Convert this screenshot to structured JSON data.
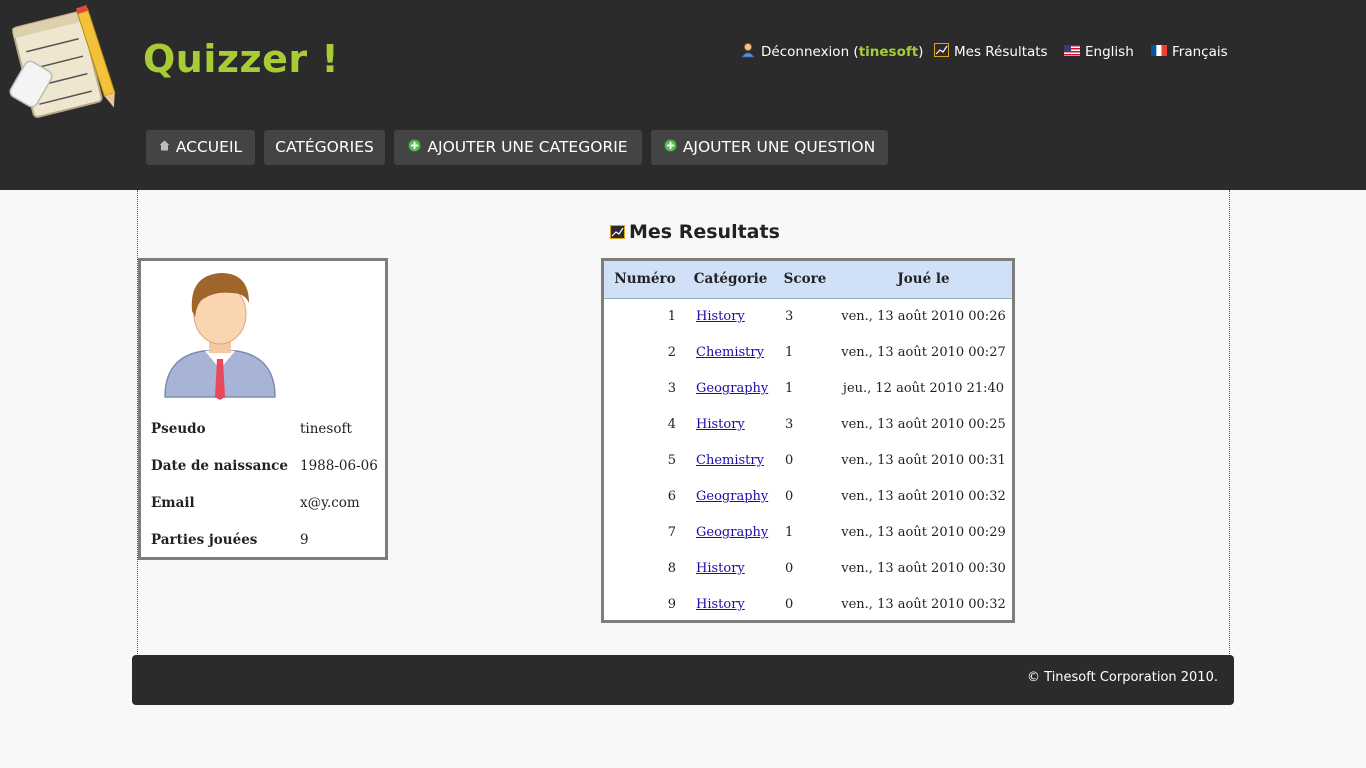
{
  "header": {
    "site_title": "Quizzer !",
    "logo_icon": "notepad-pencil-logo-icon",
    "top_links": {
      "logout_prefix": "Déconnexion (",
      "username": "tinesoft",
      "logout_suffix": ")",
      "my_results": "Mes Résultats",
      "english": "English",
      "french": "Français"
    },
    "nav": [
      {
        "label": "ACCUEIL",
        "icon": "home-icon"
      },
      {
        "label": "CATÉGORIES"
      },
      {
        "label": "AJOUTER UNE CATEGORIE",
        "icon": "plus-circle-icon"
      },
      {
        "label": "AJOUTER UNE QUESTION",
        "icon": "plus-circle-icon"
      }
    ]
  },
  "profile": {
    "rows": [
      {
        "label": "Pseudo",
        "value": "tinesoft"
      },
      {
        "label": "Date de naissance",
        "value": "1988-06-06"
      },
      {
        "label": "Email",
        "value": "x@y.com"
      },
      {
        "label": "Parties jouées",
        "value": "9"
      }
    ]
  },
  "results": {
    "title": "Mes Resultats",
    "columns": [
      "Numéro",
      "Catégorie",
      "Score",
      "Joué le"
    ],
    "rows": [
      {
        "num": "1",
        "category": "History",
        "score": "3",
        "date": "ven., 13 août 2010 00:26"
      },
      {
        "num": "2",
        "category": "Chemistry",
        "score": "1",
        "date": "ven., 13 août 2010 00:27"
      },
      {
        "num": "3",
        "category": "Geography",
        "score": "1",
        "date": "jeu., 12 août 2010 21:40"
      },
      {
        "num": "4",
        "category": "History",
        "score": "3",
        "date": "ven., 13 août 2010 00:25"
      },
      {
        "num": "5",
        "category": "Chemistry",
        "score": "0",
        "date": "ven., 13 août 2010 00:31"
      },
      {
        "num": "6",
        "category": "Geography",
        "score": "0",
        "date": "ven., 13 août 2010 00:32"
      },
      {
        "num": "7",
        "category": "Geography",
        "score": "1",
        "date": "ven., 13 août 2010 00:29"
      },
      {
        "num": "8",
        "category": "History",
        "score": "0",
        "date": "ven., 13 août 2010 00:30"
      },
      {
        "num": "9",
        "category": "History",
        "score": "0",
        "date": "ven., 13 août 2010 00:32"
      }
    ]
  },
  "footer": {
    "copyright": "© Tinesoft Corporation 2010."
  },
  "colors": {
    "header_bg": "#2b2b2b",
    "accent_green": "#a8cc36",
    "nav_button_bg": "#444444",
    "table_header_bg": "#cfe0f7",
    "link_blue": "#1a0dab"
  }
}
